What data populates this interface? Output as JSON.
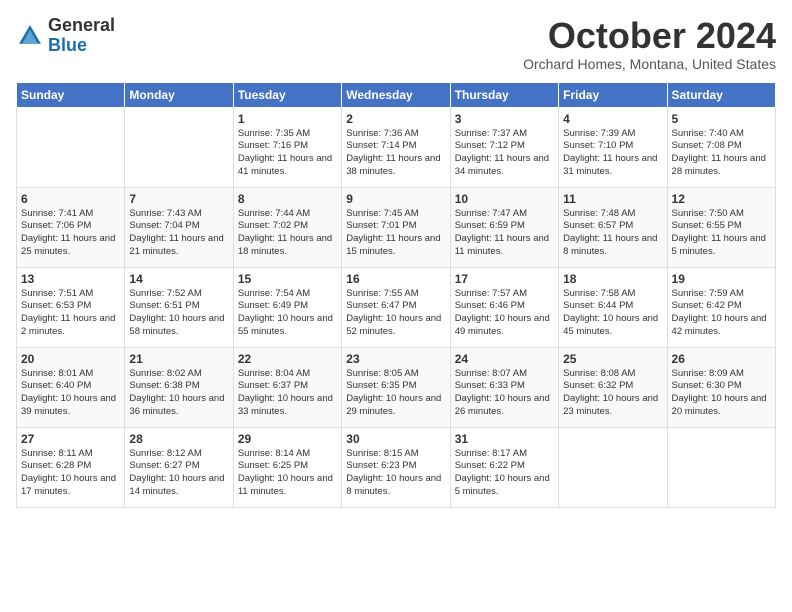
{
  "header": {
    "logo_general": "General",
    "logo_blue": "Blue",
    "month_title": "October 2024",
    "location": "Orchard Homes, Montana, United States"
  },
  "days_of_week": [
    "Sunday",
    "Monday",
    "Tuesday",
    "Wednesday",
    "Thursday",
    "Friday",
    "Saturday"
  ],
  "weeks": [
    [
      {
        "day": "",
        "sunrise": "",
        "sunset": "",
        "daylight": ""
      },
      {
        "day": "",
        "sunrise": "",
        "sunset": "",
        "daylight": ""
      },
      {
        "day": "1",
        "sunrise": "Sunrise: 7:35 AM",
        "sunset": "Sunset: 7:16 PM",
        "daylight": "Daylight: 11 hours and 41 minutes."
      },
      {
        "day": "2",
        "sunrise": "Sunrise: 7:36 AM",
        "sunset": "Sunset: 7:14 PM",
        "daylight": "Daylight: 11 hours and 38 minutes."
      },
      {
        "day": "3",
        "sunrise": "Sunrise: 7:37 AM",
        "sunset": "Sunset: 7:12 PM",
        "daylight": "Daylight: 11 hours and 34 minutes."
      },
      {
        "day": "4",
        "sunrise": "Sunrise: 7:39 AM",
        "sunset": "Sunset: 7:10 PM",
        "daylight": "Daylight: 11 hours and 31 minutes."
      },
      {
        "day": "5",
        "sunrise": "Sunrise: 7:40 AM",
        "sunset": "Sunset: 7:08 PM",
        "daylight": "Daylight: 11 hours and 28 minutes."
      }
    ],
    [
      {
        "day": "6",
        "sunrise": "Sunrise: 7:41 AM",
        "sunset": "Sunset: 7:06 PM",
        "daylight": "Daylight: 11 hours and 25 minutes."
      },
      {
        "day": "7",
        "sunrise": "Sunrise: 7:43 AM",
        "sunset": "Sunset: 7:04 PM",
        "daylight": "Daylight: 11 hours and 21 minutes."
      },
      {
        "day": "8",
        "sunrise": "Sunrise: 7:44 AM",
        "sunset": "Sunset: 7:02 PM",
        "daylight": "Daylight: 11 hours and 18 minutes."
      },
      {
        "day": "9",
        "sunrise": "Sunrise: 7:45 AM",
        "sunset": "Sunset: 7:01 PM",
        "daylight": "Daylight: 11 hours and 15 minutes."
      },
      {
        "day": "10",
        "sunrise": "Sunrise: 7:47 AM",
        "sunset": "Sunset: 6:59 PM",
        "daylight": "Daylight: 11 hours and 11 minutes."
      },
      {
        "day": "11",
        "sunrise": "Sunrise: 7:48 AM",
        "sunset": "Sunset: 6:57 PM",
        "daylight": "Daylight: 11 hours and 8 minutes."
      },
      {
        "day": "12",
        "sunrise": "Sunrise: 7:50 AM",
        "sunset": "Sunset: 6:55 PM",
        "daylight": "Daylight: 11 hours and 5 minutes."
      }
    ],
    [
      {
        "day": "13",
        "sunrise": "Sunrise: 7:51 AM",
        "sunset": "Sunset: 6:53 PM",
        "daylight": "Daylight: 11 hours and 2 minutes."
      },
      {
        "day": "14",
        "sunrise": "Sunrise: 7:52 AM",
        "sunset": "Sunset: 6:51 PM",
        "daylight": "Daylight: 10 hours and 58 minutes."
      },
      {
        "day": "15",
        "sunrise": "Sunrise: 7:54 AM",
        "sunset": "Sunset: 6:49 PM",
        "daylight": "Daylight: 10 hours and 55 minutes."
      },
      {
        "day": "16",
        "sunrise": "Sunrise: 7:55 AM",
        "sunset": "Sunset: 6:47 PM",
        "daylight": "Daylight: 10 hours and 52 minutes."
      },
      {
        "day": "17",
        "sunrise": "Sunrise: 7:57 AM",
        "sunset": "Sunset: 6:46 PM",
        "daylight": "Daylight: 10 hours and 49 minutes."
      },
      {
        "day": "18",
        "sunrise": "Sunrise: 7:58 AM",
        "sunset": "Sunset: 6:44 PM",
        "daylight": "Daylight: 10 hours and 45 minutes."
      },
      {
        "day": "19",
        "sunrise": "Sunrise: 7:59 AM",
        "sunset": "Sunset: 6:42 PM",
        "daylight": "Daylight: 10 hours and 42 minutes."
      }
    ],
    [
      {
        "day": "20",
        "sunrise": "Sunrise: 8:01 AM",
        "sunset": "Sunset: 6:40 PM",
        "daylight": "Daylight: 10 hours and 39 minutes."
      },
      {
        "day": "21",
        "sunrise": "Sunrise: 8:02 AM",
        "sunset": "Sunset: 6:38 PM",
        "daylight": "Daylight: 10 hours and 36 minutes."
      },
      {
        "day": "22",
        "sunrise": "Sunrise: 8:04 AM",
        "sunset": "Sunset: 6:37 PM",
        "daylight": "Daylight: 10 hours and 33 minutes."
      },
      {
        "day": "23",
        "sunrise": "Sunrise: 8:05 AM",
        "sunset": "Sunset: 6:35 PM",
        "daylight": "Daylight: 10 hours and 29 minutes."
      },
      {
        "day": "24",
        "sunrise": "Sunrise: 8:07 AM",
        "sunset": "Sunset: 6:33 PM",
        "daylight": "Daylight: 10 hours and 26 minutes."
      },
      {
        "day": "25",
        "sunrise": "Sunrise: 8:08 AM",
        "sunset": "Sunset: 6:32 PM",
        "daylight": "Daylight: 10 hours and 23 minutes."
      },
      {
        "day": "26",
        "sunrise": "Sunrise: 8:09 AM",
        "sunset": "Sunset: 6:30 PM",
        "daylight": "Daylight: 10 hours and 20 minutes."
      }
    ],
    [
      {
        "day": "27",
        "sunrise": "Sunrise: 8:11 AM",
        "sunset": "Sunset: 6:28 PM",
        "daylight": "Daylight: 10 hours and 17 minutes."
      },
      {
        "day": "28",
        "sunrise": "Sunrise: 8:12 AM",
        "sunset": "Sunset: 6:27 PM",
        "daylight": "Daylight: 10 hours and 14 minutes."
      },
      {
        "day": "29",
        "sunrise": "Sunrise: 8:14 AM",
        "sunset": "Sunset: 6:25 PM",
        "daylight": "Daylight: 10 hours and 11 minutes."
      },
      {
        "day": "30",
        "sunrise": "Sunrise: 8:15 AM",
        "sunset": "Sunset: 6:23 PM",
        "daylight": "Daylight: 10 hours and 8 minutes."
      },
      {
        "day": "31",
        "sunrise": "Sunrise: 8:17 AM",
        "sunset": "Sunset: 6:22 PM",
        "daylight": "Daylight: 10 hours and 5 minutes."
      },
      {
        "day": "",
        "sunrise": "",
        "sunset": "",
        "daylight": ""
      },
      {
        "day": "",
        "sunrise": "",
        "sunset": "",
        "daylight": ""
      }
    ]
  ]
}
